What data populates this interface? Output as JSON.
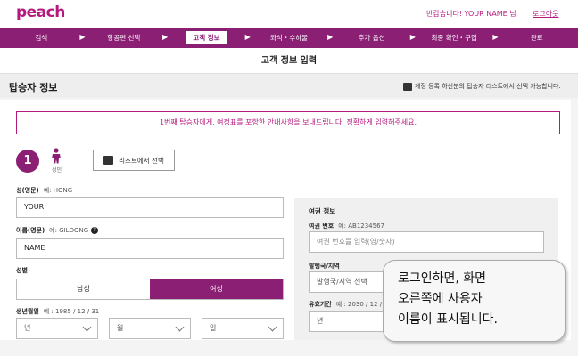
{
  "header": {
    "logo": "peach",
    "welcome": "반갑습니다! YOUR NAME 님",
    "logout": "로그아웃"
  },
  "steps": [
    {
      "label": "검색",
      "active": false
    },
    {
      "label": "항공편 선택",
      "active": false
    },
    {
      "label": "고객 정보",
      "active": true
    },
    {
      "label": "좌석・수하물",
      "active": false
    },
    {
      "label": "추가 옵션",
      "active": false
    },
    {
      "label": "최종 확인・구입",
      "active": false
    },
    {
      "label": "완료",
      "active": false
    }
  ],
  "page_title": "고객 정보 입력",
  "section": {
    "title": "탑승자 정보",
    "note": "계정 등록 하신분의 탑승자 리스트에서 선택 가능합니다."
  },
  "notice": "1번째 탑승자에게, 여정표를 포함한 안내사항을 보내드립니다. 정확하게 입력해주세요.",
  "passenger": {
    "number": "1",
    "type": "성인",
    "list_button": "리스트에서 선택"
  },
  "form": {
    "surname_label": "성(영문)",
    "surname_example": "예: HONG",
    "surname_value": "YOUR",
    "given_label": "이름(영문)",
    "given_example": "예: GILDONG",
    "given_value": "NAME",
    "gender_label": "성별",
    "male": "남성",
    "female": "여성",
    "birth_label": "생년월일",
    "birth_example": "예 : 1985 / 12 / 31",
    "year": "년",
    "month": "월",
    "day": "일"
  },
  "passport": {
    "title": "여권 정보",
    "number_label": "여권 번호",
    "number_example": "예: AB1234567",
    "number_placeholder": "여권 번호를 입력(영/숫자)",
    "country_label": "발행국/지역",
    "country_value": "발행국/지역 선택",
    "expiry_label": "유효기간",
    "expiry_example": "예 : 2030 / 12 / 3",
    "expiry_year": "년"
  },
  "tooltip": {
    "line1": "로그인하면, 화면",
    "line2": "오른쪽에 사용자",
    "line3": "이름이 표시됩니다."
  },
  "colors": {
    "brand": "#b5197e",
    "nav": "#8a1f74"
  }
}
